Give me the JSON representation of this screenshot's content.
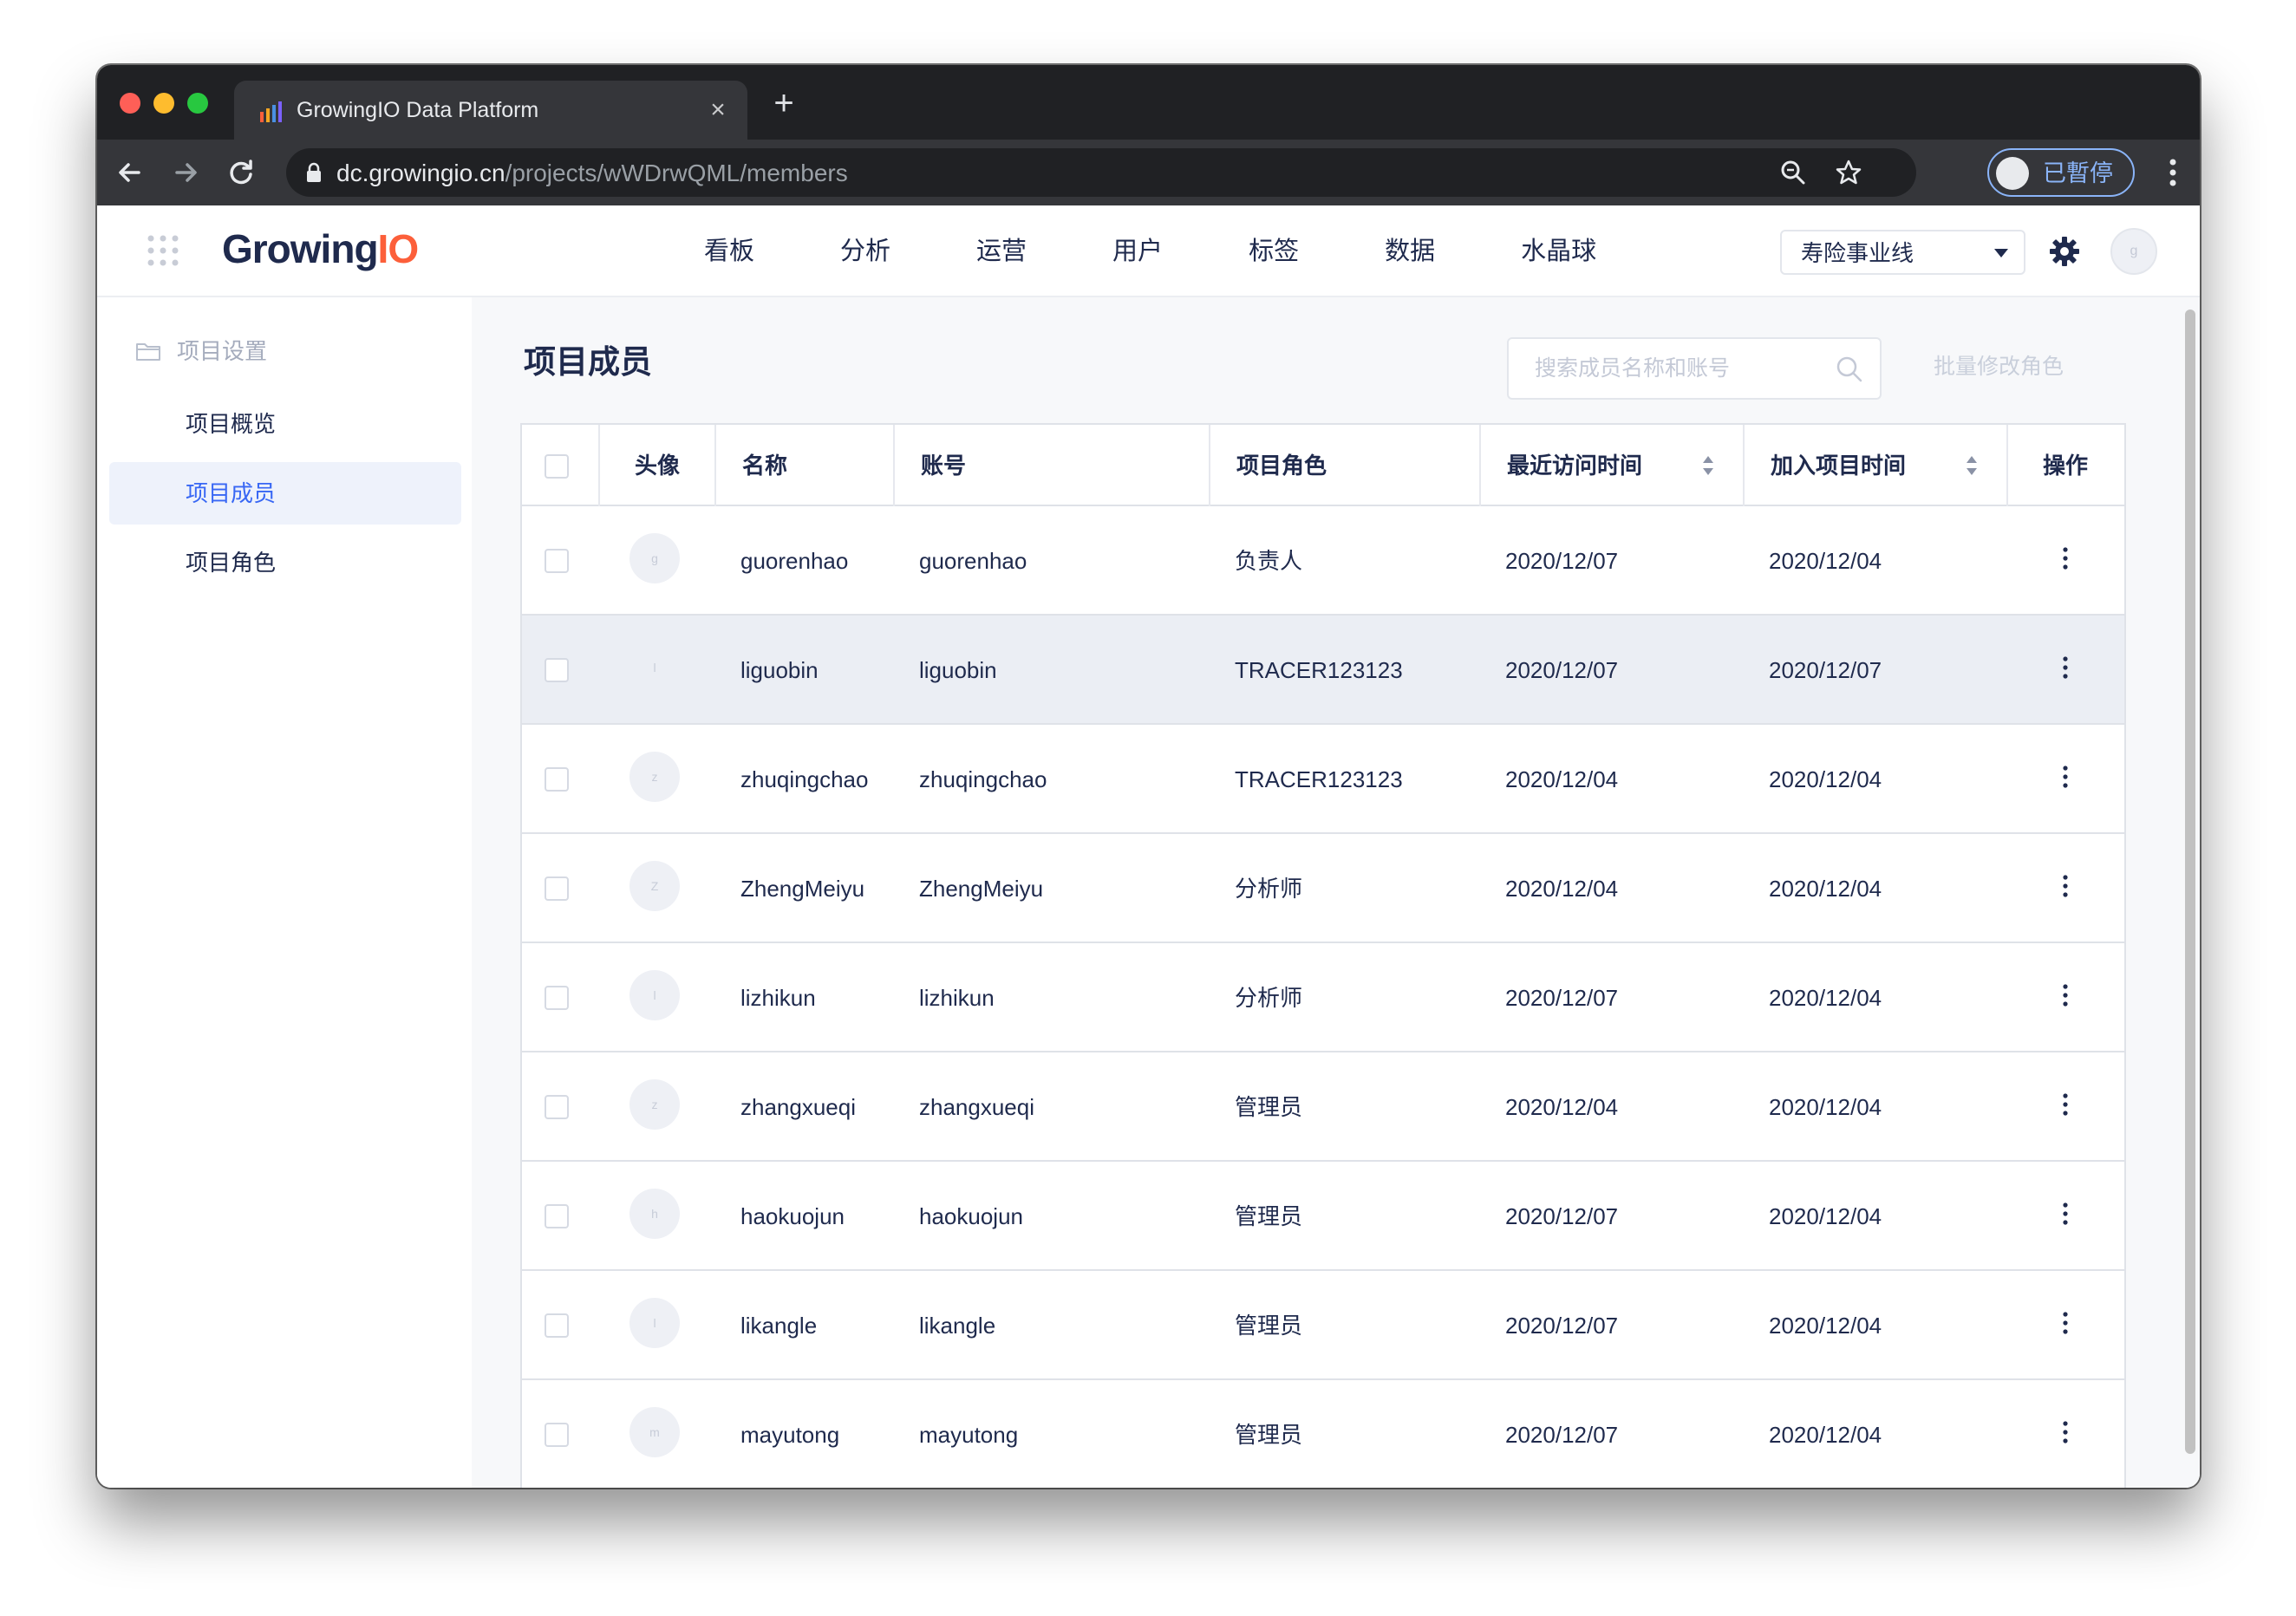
{
  "browser": {
    "tab_title": "GrowingIO Data Platform",
    "url_host": "dc.growingio.cn",
    "url_path": "/projects/wWDrwQML/members",
    "profile_label": "已暫停"
  },
  "header": {
    "logo_text_a": "Growing",
    "logo_text_b": "IO",
    "nav": [
      "看板",
      "分析",
      "运营",
      "用户",
      "标签",
      "数据",
      "水晶球"
    ],
    "business_line": "寿险事业线",
    "user_initial": "g"
  },
  "sidebar": {
    "group_label": "项目设置",
    "items": [
      {
        "label": "项目概览",
        "active": false
      },
      {
        "label": "项目成员",
        "active": true
      },
      {
        "label": "项目角色",
        "active": false
      }
    ]
  },
  "page": {
    "title": "项目成员",
    "search_placeholder": "搜索成员名称和账号",
    "batch_button": "批量修改角色"
  },
  "table": {
    "columns": {
      "avatar": "头像",
      "name": "名称",
      "account": "账号",
      "role": "项目角色",
      "last_visit": "最近访问时间",
      "joined": "加入项目时间",
      "actions": "操作"
    },
    "rows": [
      {
        "initial": "g",
        "name": "guorenhao",
        "account": "guorenhao",
        "role": "负责人",
        "last_visit": "2020/12/07",
        "joined": "2020/12/04"
      },
      {
        "initial": "l",
        "name": "liguobin",
        "account": "liguobin",
        "role": "TRACER123123",
        "last_visit": "2020/12/07",
        "joined": "2020/12/07"
      },
      {
        "initial": "z",
        "name": "zhuqingchao",
        "account": "zhuqingchao",
        "role": "TRACER123123",
        "last_visit": "2020/12/04",
        "joined": "2020/12/04"
      },
      {
        "initial": "Z",
        "name": "ZhengMeiyu",
        "account": "ZhengMeiyu",
        "role": "分析师",
        "last_visit": "2020/12/04",
        "joined": "2020/12/04"
      },
      {
        "initial": "l",
        "name": "lizhikun",
        "account": "lizhikun",
        "role": "分析师",
        "last_visit": "2020/12/07",
        "joined": "2020/12/04"
      },
      {
        "initial": "z",
        "name": "zhangxueqi",
        "account": "zhangxueqi",
        "role": "管理员",
        "last_visit": "2020/12/04",
        "joined": "2020/12/04"
      },
      {
        "initial": "h",
        "name": "haokuojun",
        "account": "haokuojun",
        "role": "管理员",
        "last_visit": "2020/12/07",
        "joined": "2020/12/04"
      },
      {
        "initial": "l",
        "name": "likangle",
        "account": "likangle",
        "role": "管理员",
        "last_visit": "2020/12/07",
        "joined": "2020/12/04"
      },
      {
        "initial": "m",
        "name": "mayutong",
        "account": "mayutong",
        "role": "管理员",
        "last_visit": "2020/12/07",
        "joined": "2020/12/04"
      }
    ]
  },
  "colors": {
    "accent": "#3867f4",
    "logo_orange": "#fc5f3a",
    "text_primary": "#1f2a4d"
  }
}
